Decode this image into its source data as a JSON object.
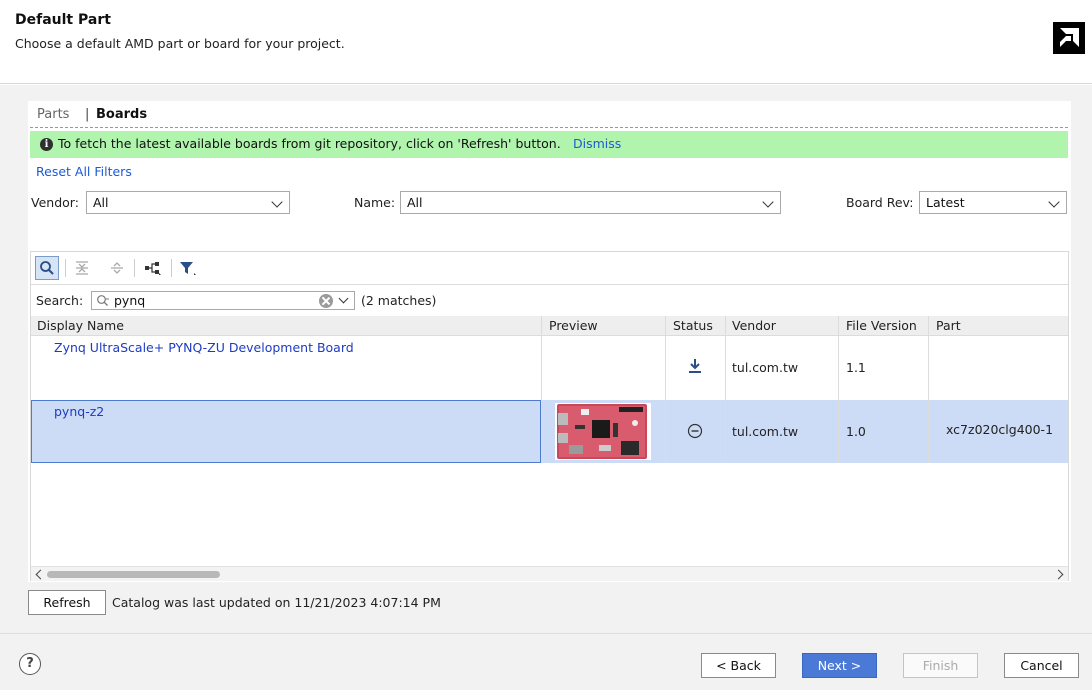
{
  "header": {
    "title": "Default Part",
    "subtitle": "Choose a default AMD part or board for your project."
  },
  "tabs": {
    "parts": "Parts",
    "separator": "|",
    "boards": "Boards"
  },
  "banner": {
    "message": "To fetch the latest available boards from git repository, click on 'Refresh' button.",
    "dismiss": "Dismiss"
  },
  "filters": {
    "reset": "Reset All Filters",
    "vendor_label": "Vendor:",
    "vendor_value": "All",
    "name_label": "Name:",
    "name_value": "All",
    "board_rev_label": "Board Rev:",
    "board_rev_value": "Latest"
  },
  "search": {
    "label": "Search:",
    "value": "pynq",
    "matches": "(2 matches)"
  },
  "table": {
    "columns": [
      "Display Name",
      "Preview",
      "Status",
      "Vendor",
      "File Version",
      "Part"
    ],
    "rows": [
      {
        "display_name": "Zynq UltraScale+ PYNQ-ZU Development Board",
        "status_icon": "download-icon",
        "vendor": "tul.com.tw",
        "file_version": "1.1",
        "part": ""
      },
      {
        "display_name": "pynq-z2",
        "status_icon": "minus-circle-icon",
        "vendor": "tul.com.tw",
        "file_version": "1.0",
        "part": "xc7z020clg400-1"
      }
    ]
  },
  "refresh": {
    "label": "Refresh",
    "catalog_text": "Catalog was last updated on 11/21/2023 4:07:14 PM"
  },
  "footer": {
    "help": "?",
    "back": "< Back",
    "next": "Next >",
    "finish": "Finish",
    "cancel": "Cancel"
  },
  "colors": {
    "banner": "#b0f4ae",
    "link": "#1e5ad6",
    "selected_row": "#cddcf6",
    "primary_button": "#4a7ad6"
  }
}
